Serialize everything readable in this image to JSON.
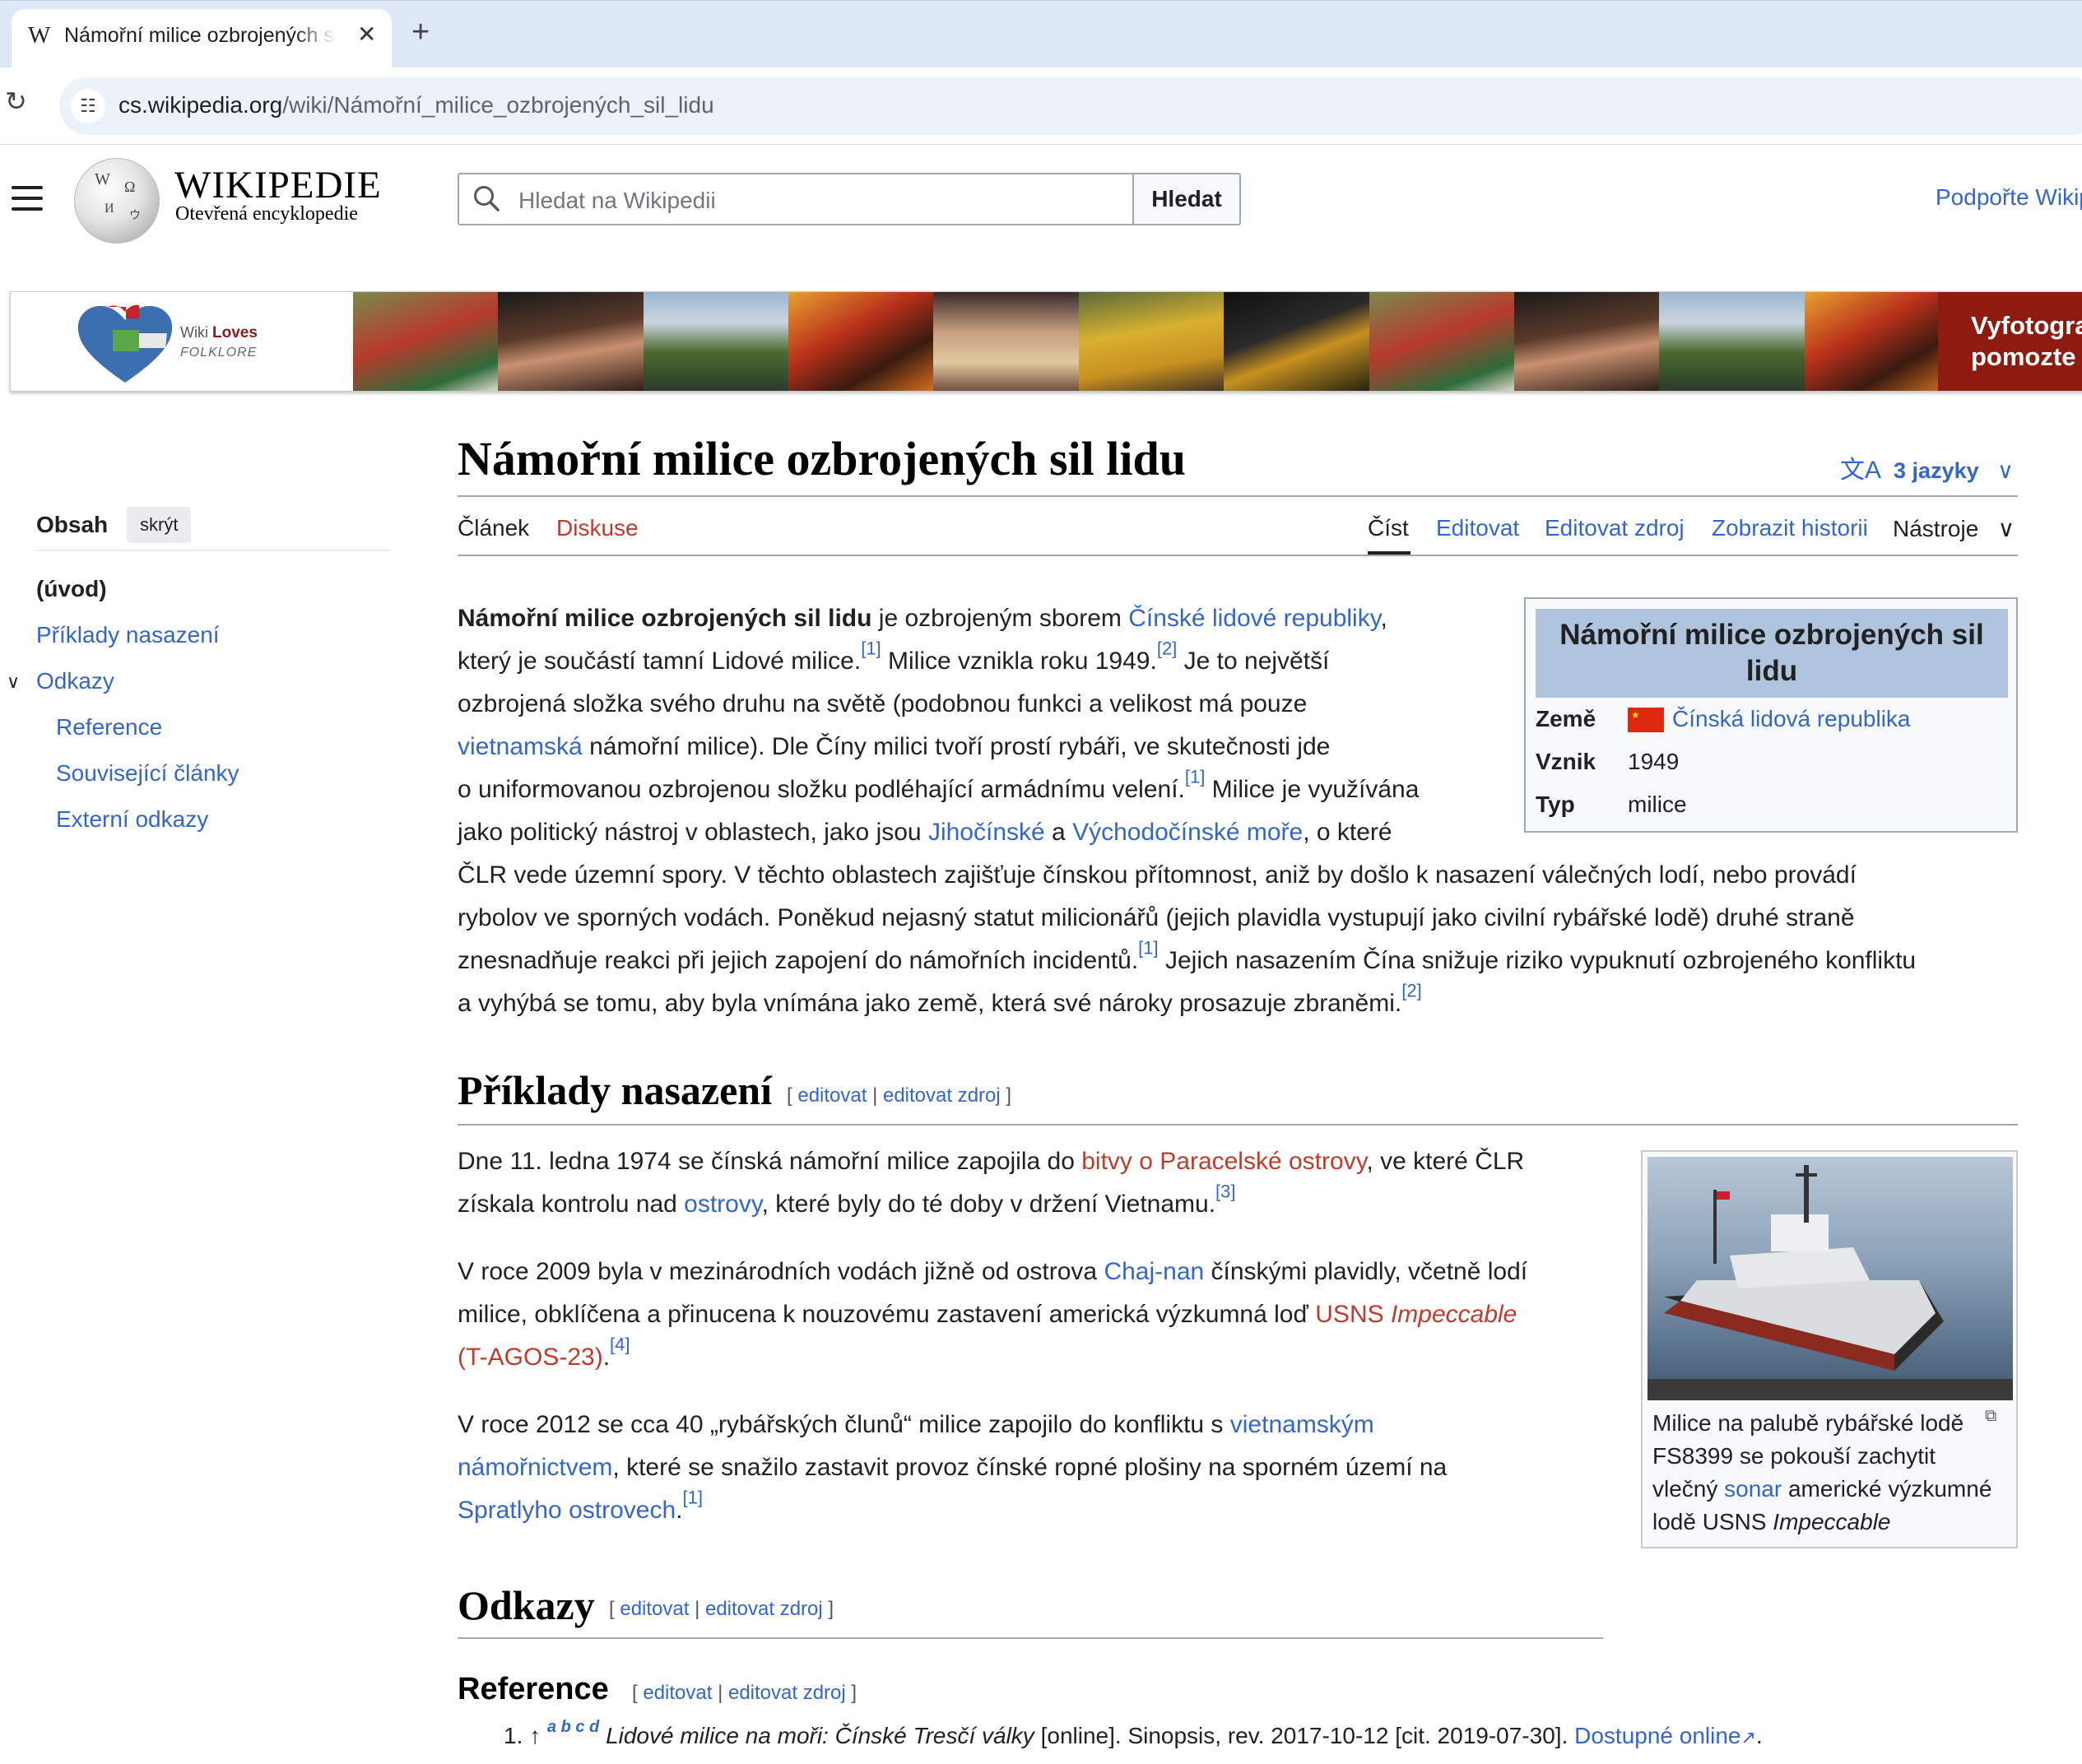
{
  "browser": {
    "tab_title": "Námořní milice ozbrojených sil lidu",
    "tab_favicon": "W",
    "url_host": "cs.wikipedia.org",
    "url_path": "/wiki/Námořní_milice_ozbrojených_sil_lidu"
  },
  "header": {
    "wordmark": "WIKIPEDIE",
    "tagline": "Otevřená encyklopedie",
    "search_placeholder": "Hledat na Wikipedii",
    "search_button": "Hledat",
    "donate": "Podpořte Wikipedii"
  },
  "banner": {
    "logo_line1": "Wiki",
    "logo_line2": "Loves",
    "logo_line3": "FOLKLORE",
    "cta_line1": "Vyfotografujte",
    "cta_line2": "pomozte"
  },
  "toc": {
    "title": "Obsah",
    "hide": "skrýt",
    "items": [
      "(úvod)",
      "Příklady nasazení",
      "Odkazy",
      "Reference",
      "Související články",
      "Externí odkazy"
    ]
  },
  "article": {
    "title": "Námořní milice ozbrojených sil lidu",
    "languages": "3 jazyky",
    "tabs": {
      "article": "Článek",
      "talk": "Diskuse",
      "read": "Číst",
      "edit": "Editovat",
      "edit_source": "Editovat zdroj",
      "history": "Zobrazit historii",
      "tools": "Nástroje"
    },
    "lead": {
      "l1a": "Námořní milice ozbrojených sil lidu",
      "l1b": " je ozbrojeným sborem ",
      "l1c": "Čínské lidové republiky",
      "l1d": ",",
      "l2a": "který je součástí tamní Lidové milice.",
      "l2b": " Milice vznikla roku 1949.",
      "l2c": " Je to největší",
      "l3": "ozbrojená složka svého druhu na světě (podobnou funkci a velikost má pouze",
      "l4a": "vietnamská",
      "l4b": " námořní milice). Dle Číny milici tvoří prostí rybáři, ve skutečnosti jde",
      "l5a": "o uniformovanou ozbrojenou složku podléhající armádnímu velení.",
      "l5b": " Milice je využívána",
      "l6a": "jako politický nástroj v oblastech, jako jsou ",
      "l6b": "Jihočínské",
      "l6c": " a ",
      "l6d": "Východočínské moře",
      "l6e": ", o které",
      "l7": "ČLR vede územní spory. V těchto oblastech zajišťuje čínskou přítomnost, aniž by došlo k nasazení válečných lodí, nebo provádí",
      "l8": "rybolov ve sporných vodách. Poněkud nejasný statut milicionářů (jejich plavidla vystupují jako civilní rybářské lodě) druhé straně",
      "l9a": "znesnadňuje reakci při jejich zapojení do námořních incidentů.",
      "l9b": " Jejich nasazením Čína snižuje riziko vypuknutí ozbrojeného konfliktu",
      "l10": "a vyhýbá se tomu, aby byla vnímána jako země, která své nároky prosazuje zbraněmi.",
      "ref1": "[1]",
      "ref2": "[2]",
      "ref3": "[3]",
      "ref4": "[4]"
    },
    "infobox": {
      "title": "Námořní milice ozbrojených sil lidu",
      "rows": [
        {
          "label": "Země",
          "value": "Čínská lidová republika"
        },
        {
          "label": "Vznik",
          "value": "1949"
        },
        {
          "label": "Typ",
          "value": "milice"
        }
      ]
    },
    "sections": {
      "examples": "Příklady nasazení",
      "links": "Odkazy",
      "references": "Reference",
      "edit": "editovat",
      "edit_source": "editovat zdroj",
      "bracket_open": "[",
      "bracket_close": "]",
      "sep": "|"
    },
    "examples": {
      "p1a": "Dne 11. ledna 1974 se čínská námořní milice zapojila do ",
      "p1b": "bitvy o Paracelské ostrovy",
      "p1c": ", ve které ČLR",
      "p1d": "získala kontrolu nad ",
      "p1e": "ostrovy",
      "p1f": ", které byly do té doby v držení Vietnamu.",
      "p2a": "V roce 2009 byla v mezinárodních vodách jižně od ostrova ",
      "p2b": "Chaj-nan",
      "p2c": " čínskými plavidly, včetně lodí",
      "p2d": "milice, obklíčena a přinucena k nouzovému zastavení americká výzkumná loď ",
      "p2e": "USNS ",
      "p2f": "Impeccable",
      "p2g": "(T-AGOS-23)",
      "p2h": ".",
      "p3a": "V roce 2012 se cca 40 „rybářských člunů“ milice zapojilo do konfliktu s ",
      "p3b": "vietnamským",
      "p3c": "námořnictvem",
      "p3d": ", které se snažilo zastavit provoz čínské ropné plošiny na sporném území na",
      "p3e": "Spratlyho ostrovech",
      "p3f": "."
    },
    "thumb": {
      "cap1": "Milice na palubě rybářské lodě",
      "cap2": "FS8399 se pokouší zachytit",
      "cap3a": "vlečný ",
      "cap3b": "sonar",
      "cap3c": " americké výzkumné",
      "cap4a": "lodě USNS ",
      "cap4b": "Impeccable"
    },
    "ref_list": {
      "num": "1.",
      "arrow": "↑",
      "backlinks": "a b c d",
      "title": "Lidové milice na moři: Čínské Tresčí války",
      "rest": " [online]. Sinopsis, rev. 2017-10-12 [cit. 2019-07-30]. ",
      "link": "Dostupné online",
      "end": "."
    }
  }
}
